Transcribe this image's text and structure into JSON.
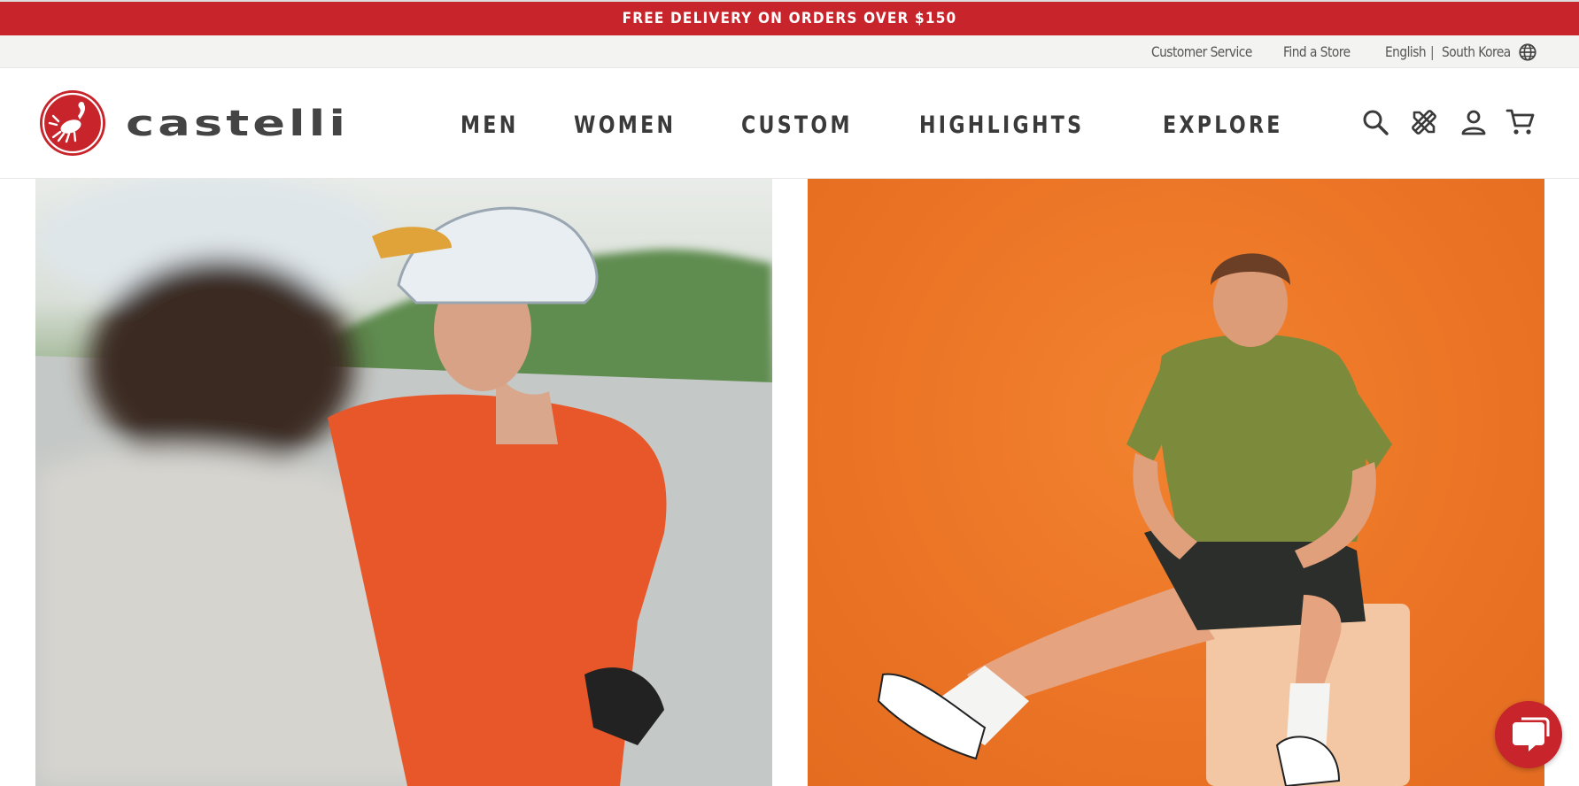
{
  "promo": {
    "text": "FREE DELIVERY ON ORDERS OVER $150"
  },
  "utility": {
    "customer_service": "Customer Service",
    "find_store": "Find a Store",
    "language": "English",
    "separator": "|",
    "region": "South Korea",
    "globe_icon": "globe-icon"
  },
  "header": {
    "brand": "castelli",
    "nav": [
      "MEN",
      "WOMEN",
      "CUSTOM",
      "HIGHLIGHTS",
      "EXPLORE"
    ],
    "icons": [
      "search-icon",
      "custom-tools-icon",
      "account-icon",
      "cart-icon"
    ]
  },
  "colors": {
    "brand_red": "#c8242b",
    "nav_text": "#3a3a3a",
    "utility_bg": "#f3f3f2",
    "hero_orange": "#ec7628"
  },
  "chat": {
    "icon": "chat-icon"
  }
}
